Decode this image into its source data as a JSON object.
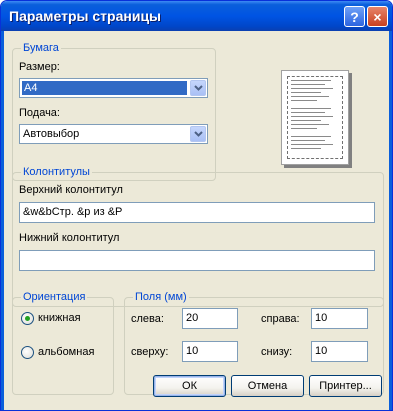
{
  "window": {
    "title": "Параметры страницы",
    "help_glyph": "?",
    "close_glyph": "×"
  },
  "paper": {
    "legend": "Бумага",
    "size_label": "Размер:",
    "size_value": "A4",
    "source_label": "Подача:",
    "source_value": "Автовыбор"
  },
  "headers": {
    "legend": "Колонтитулы",
    "header_label": "Верхний колонтитул",
    "header_value": "&w&bСтр. &p из &P",
    "footer_label": "Нижний колонтитул",
    "footer_value": ""
  },
  "orientation": {
    "legend": "Ориентация",
    "portrait": "книжная",
    "landscape": "альбомная",
    "selected": "portrait"
  },
  "margins": {
    "legend": "Поля (мм)",
    "left_label": "слева:",
    "left_value": "20",
    "right_label": "справа:",
    "right_value": "10",
    "top_label": "сверху:",
    "top_value": "10",
    "bottom_label": "снизу:",
    "bottom_value": "10"
  },
  "buttons": {
    "ok": "ОК",
    "cancel": "Отмена",
    "printer": "Принтер..."
  },
  "colors": {
    "accent": "#0054e3",
    "legend_text": "#0046d5",
    "selection": "#316ac5"
  }
}
